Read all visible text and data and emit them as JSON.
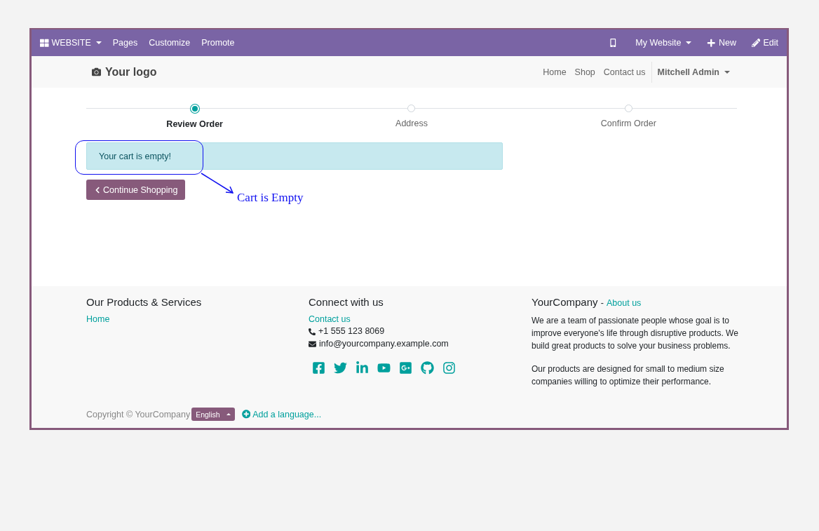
{
  "editor_bar": {
    "app_menu": "WEBSITE",
    "menu": [
      "Pages",
      "Customize",
      "Promote"
    ],
    "site_switcher": "My Website",
    "new_label": "New",
    "edit_label": "Edit"
  },
  "header": {
    "logo": "Your logo",
    "nav": [
      "Home",
      "Shop",
      "Contact us"
    ],
    "user": "Mitchell Admin"
  },
  "checkout_steps": [
    {
      "label": "Review Order",
      "selected": true
    },
    {
      "label": "Address",
      "selected": false
    },
    {
      "label": "Confirm Order",
      "selected": false
    }
  ],
  "alert": "Your cart is empty!",
  "continue_button": "Continue Shopping",
  "annotation": {
    "label": "Cart is Empty"
  },
  "footer": {
    "products": {
      "title": "Our Products & Services",
      "links": [
        "Home"
      ]
    },
    "connect": {
      "title": "Connect with us",
      "contact_link": "Contact us",
      "phone": "+1 555 123 8069",
      "email": "info@yourcompany.example.com"
    },
    "about": {
      "company": "YourCompany",
      "separator": "-",
      "link": "About us",
      "paragraphs": [
        "We are a team of passionate people whose goal is to improve everyone's life through disruptive products. We build great products to solve your business problems.",
        "Our products are designed for small to medium size companies willing to optimize their performance."
      ]
    },
    "copyright": "Copyright © YourCompany",
    "language": "English",
    "add_language": "Add a language..."
  }
}
